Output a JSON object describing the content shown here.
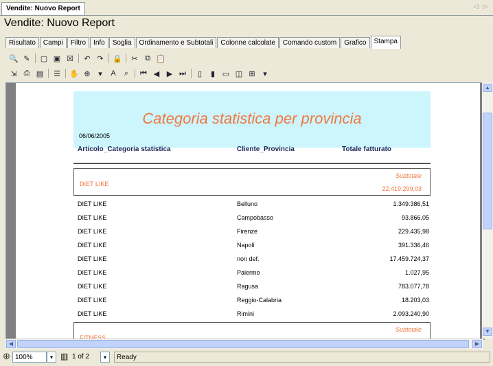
{
  "doc_tab": {
    "label": "Vendite: Nuovo Report",
    "nav": "◁ ▷"
  },
  "window_title": "Vendite: Nuovo Report",
  "tabs": [
    "Risultato",
    "Campi",
    "Filtro",
    "Info",
    "Soglia",
    "Ordinamento e Subtotali",
    "Colonne calcolate",
    "Comando custom",
    "Grafico",
    "Stampa"
  ],
  "active_tab": "Stampa",
  "report": {
    "title": "Categoria statistica per provincia",
    "date": "06/06/2005",
    "columns": [
      "Articolo_Categoria statistica",
      "Cliente_Provincia",
      "Totale fatturato"
    ],
    "groups": [
      {
        "name": "DIET LIKE",
        "subtotal_label": "Subtotale",
        "subtotal_value": "22.419.299,03",
        "rows": [
          {
            "category": "DIET LIKE",
            "province": "Belluno",
            "total": "1.349.386,51"
          },
          {
            "category": "DIET LIKE",
            "province": "Campobasso",
            "total": "93.866,05"
          },
          {
            "category": "DIET LIKE",
            "province": "Firenze",
            "total": "229.435,98"
          },
          {
            "category": "DIET LIKE",
            "province": "Napoli",
            "total": "391.336,46"
          },
          {
            "category": "DIET LIKE",
            "province": "non def.",
            "total": "17.459.724,37"
          },
          {
            "category": "DIET LIKE",
            "province": "Palermo",
            "total": "1.027,95"
          },
          {
            "category": "DIET LIKE",
            "province": "Ragusa",
            "total": "783.077,78"
          },
          {
            "category": "DIET LIKE",
            "province": "Reggio-Calabria",
            "total": "18.203,03"
          },
          {
            "category": "DIET LIKE",
            "province": "Rimini",
            "total": "2.093.240,90"
          }
        ]
      },
      {
        "name": "FITNESS",
        "subtotal_label": "Subtotale",
        "subtotal_value": "",
        "rows": []
      }
    ]
  },
  "status": {
    "zoom": "100%",
    "page": "1 of 2",
    "state": "Ready"
  }
}
